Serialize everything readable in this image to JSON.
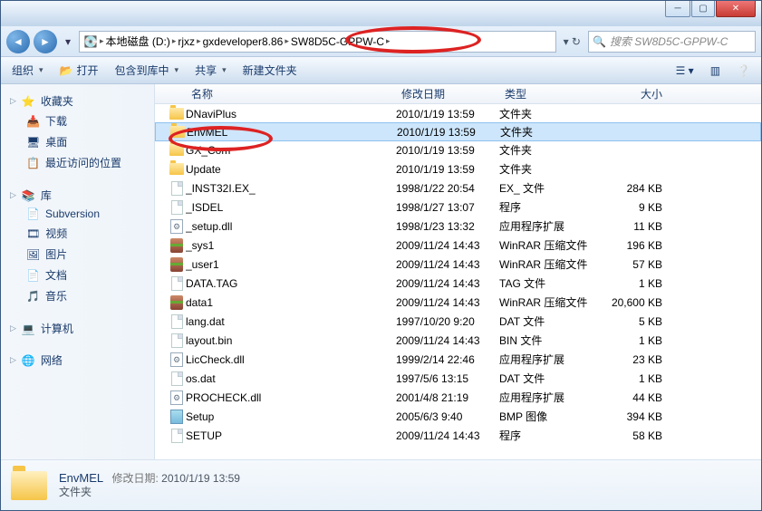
{
  "titlebar": {},
  "address": {
    "disk": "本地磁盘 (D:)",
    "seg1": "rjxz",
    "seg2": "gxdeveloper8.86",
    "seg3": "SW8D5C-GPPW-C"
  },
  "search": {
    "placeholder": "搜索 SW8D5C-GPPW-C"
  },
  "toolbar": {
    "organize": "组织",
    "open": "打开",
    "include_in_library": "包含到库中",
    "share": "共享",
    "new_folder": "新建文件夹"
  },
  "sidebar": {
    "favorites": {
      "label": "收藏夹",
      "items": [
        "下载",
        "桌面",
        "最近访问的位置"
      ]
    },
    "libraries": {
      "label": "库",
      "items": [
        "Subversion",
        "视频",
        "图片",
        "文档",
        "音乐"
      ]
    },
    "computer": {
      "label": "计算机"
    },
    "network": {
      "label": "网络"
    }
  },
  "columns": {
    "name": "名称",
    "date": "修改日期",
    "type": "类型",
    "size": "大小"
  },
  "files": [
    {
      "icon": "folder",
      "name": "DNaviPlus",
      "date": "2010/1/19 13:59",
      "type": "文件夹",
      "size": ""
    },
    {
      "icon": "folder",
      "name": "EnvMEL",
      "date": "2010/1/19 13:59",
      "type": "文件夹",
      "size": "",
      "selected": true
    },
    {
      "icon": "folder",
      "name": "GX_Com",
      "date": "2010/1/19 13:59",
      "type": "文件夹",
      "size": ""
    },
    {
      "icon": "folder",
      "name": "Update",
      "date": "2010/1/19 13:59",
      "type": "文件夹",
      "size": ""
    },
    {
      "icon": "file",
      "name": "_INST32I.EX_",
      "date": "1998/1/22 20:54",
      "type": "EX_ 文件",
      "size": "284 KB"
    },
    {
      "icon": "file",
      "name": "_ISDEL",
      "date": "1998/1/27 13:07",
      "type": "程序",
      "size": "9 KB"
    },
    {
      "icon": "dll",
      "name": "_setup.dll",
      "date": "1998/1/23 13:32",
      "type": "应用程序扩展",
      "size": "11 KB"
    },
    {
      "icon": "rar",
      "name": "_sys1",
      "date": "2009/11/24 14:43",
      "type": "WinRAR 压缩文件",
      "size": "196 KB"
    },
    {
      "icon": "rar",
      "name": "_user1",
      "date": "2009/11/24 14:43",
      "type": "WinRAR 压缩文件",
      "size": "57 KB"
    },
    {
      "icon": "file",
      "name": "DATA.TAG",
      "date": "2009/11/24 14:43",
      "type": "TAG 文件",
      "size": "1 KB"
    },
    {
      "icon": "rar",
      "name": "data1",
      "date": "2009/11/24 14:43",
      "type": "WinRAR 压缩文件",
      "size": "20,600 KB"
    },
    {
      "icon": "file",
      "name": "lang.dat",
      "date": "1997/10/20 9:20",
      "type": "DAT 文件",
      "size": "5 KB"
    },
    {
      "icon": "file",
      "name": "layout.bin",
      "date": "2009/11/24 14:43",
      "type": "BIN 文件",
      "size": "1 KB"
    },
    {
      "icon": "dll",
      "name": "LicCheck.dll",
      "date": "1999/2/14 22:46",
      "type": "应用程序扩展",
      "size": "23 KB"
    },
    {
      "icon": "file",
      "name": "os.dat",
      "date": "1997/5/6 13:15",
      "type": "DAT 文件",
      "size": "1 KB"
    },
    {
      "icon": "dll",
      "name": "PROCHECK.dll",
      "date": "2001/4/8 21:19",
      "type": "应用程序扩展",
      "size": "44 KB"
    },
    {
      "icon": "bmp",
      "name": "Setup",
      "date": "2005/6/3 9:40",
      "type": "BMP 图像",
      "size": "394 KB"
    },
    {
      "icon": "file",
      "name": "SETUP",
      "date": "2009/11/24 14:43",
      "type": "程序",
      "size": "58 KB"
    }
  ],
  "details": {
    "name": "EnvMEL",
    "date_label": "修改日期:",
    "date": "2010/1/19 13:59",
    "type": "文件夹"
  }
}
